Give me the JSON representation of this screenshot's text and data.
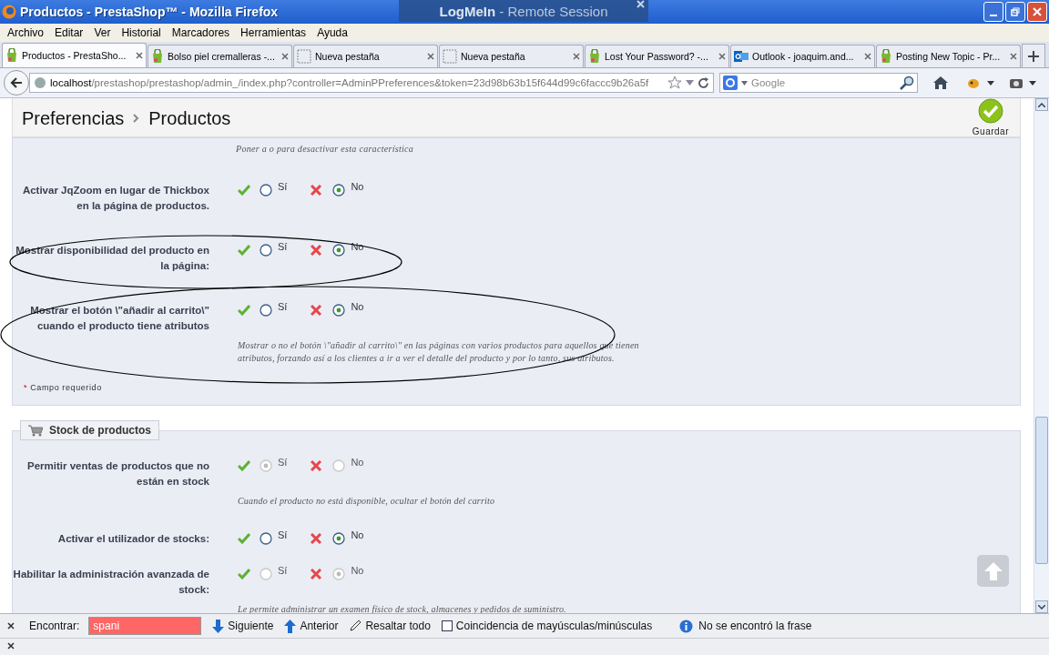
{
  "window": {
    "title": "Productos - PrestaShop™ - Mozilla Firefox",
    "remote_banner": "**LogMeIn** - Remote Session"
  },
  "menu": [
    "Archivo",
    "Editar",
    "Ver",
    "Historial",
    "Marcadores",
    "Herramientas",
    "Ayuda"
  ],
  "tabs": [
    {
      "label": "Productos - PrestaSho...",
      "kind": "shop",
      "selected": true
    },
    {
      "label": "Bolso piel cremalleras -...",
      "kind": "shop",
      "selected": false
    },
    {
      "label": "Nueva pestaña",
      "kind": "blank",
      "selected": false
    },
    {
      "label": "Nueva pestaña",
      "kind": "blank",
      "selected": false
    },
    {
      "label": "Lost Your Password? -...",
      "kind": "shop",
      "selected": false
    },
    {
      "label": "Outlook - joaquim.and...",
      "kind": "mail",
      "selected": false
    },
    {
      "label": "Posting New Topic - Pr...",
      "kind": "shop",
      "selected": false
    }
  ],
  "navbar": {
    "url_host": "localhost",
    "url_path": "/prestashop/prestashop/admin_/index.php?controller=AdminPPreferences&token=23d98b63b15f644d99c6faccc9b26a5f",
    "search_placeholder": "Google"
  },
  "page": {
    "breadcrumb": [
      "Preferencias",
      "Productos"
    ],
    "save_label": "Guardar",
    "sections": [
      {
        "top_help": "Poner a o para desactivar esta característica",
        "rows": [
          {
            "label": "Activar JqZoom en lugar de Thickbox en la página de productos.",
            "options": [
              {
                "label": "Sí",
                "selected": false,
                "disabled": false
              },
              {
                "label": "No",
                "selected": true,
                "disabled": false
              }
            ]
          },
          {
            "label": "Mostrar disponibilidad del producto en la página:",
            "options": [
              {
                "label": "Sí",
                "selected": false,
                "disabled": false
              },
              {
                "label": "No",
                "selected": true,
                "disabled": false
              }
            ]
          },
          {
            "label": "Mostrar el botón \\\"añadir al carrito\\\" cuando el producto tiene atributos",
            "options": [
              {
                "label": "Sí",
                "selected": false,
                "disabled": false
              },
              {
                "label": "No",
                "selected": true,
                "disabled": false
              }
            ],
            "help": "Mostrar o no el botón \\\"añadir al carrito\\\" en las páginas con varios productos para aquellos que tienen atributos, forzando así a los clientes a ir a ver el detalle del producto y por lo tanto, sus atributos."
          }
        ],
        "required_mark": "*",
        "required_note": "Campo requerido"
      },
      {
        "legend": "Stock de productos",
        "rows": [
          {
            "label": "Permitir ventas de productos que no están en stock",
            "options": [
              {
                "label": "Sí",
                "selected": true,
                "disabled": true
              },
              {
                "label": "No",
                "selected": false,
                "disabled": true
              }
            ],
            "help": "Cuando el producto no está disponible, ocultar el botón del carrito"
          },
          {
            "label": "Activar el utilizador de stocks:",
            "options": [
              {
                "label": "Sí",
                "selected": false,
                "disabled": false
              },
              {
                "label": "No",
                "selected": true,
                "disabled": false
              }
            ]
          },
          {
            "label": "Habilitar la administración avanzada de stock:",
            "options": [
              {
                "label": "Sí",
                "selected": false,
                "disabled": true
              },
              {
                "label": "No",
                "selected": true,
                "disabled": true
              }
            ],
            "help": "Le permite administrar un examen físico de stock, almacenes y pedidos de suministro."
          }
        ]
      }
    ]
  },
  "findbar": {
    "label": "Encontrar:",
    "value": "spani",
    "not_found": true,
    "next": "Siguiente",
    "previous": "Anterior",
    "highlight": "Resaltar todo",
    "match_case": {
      "label": "Coincidencia de mayúsculas/minúsculas",
      "checked": false
    },
    "status": "No se encontró la frase"
  }
}
